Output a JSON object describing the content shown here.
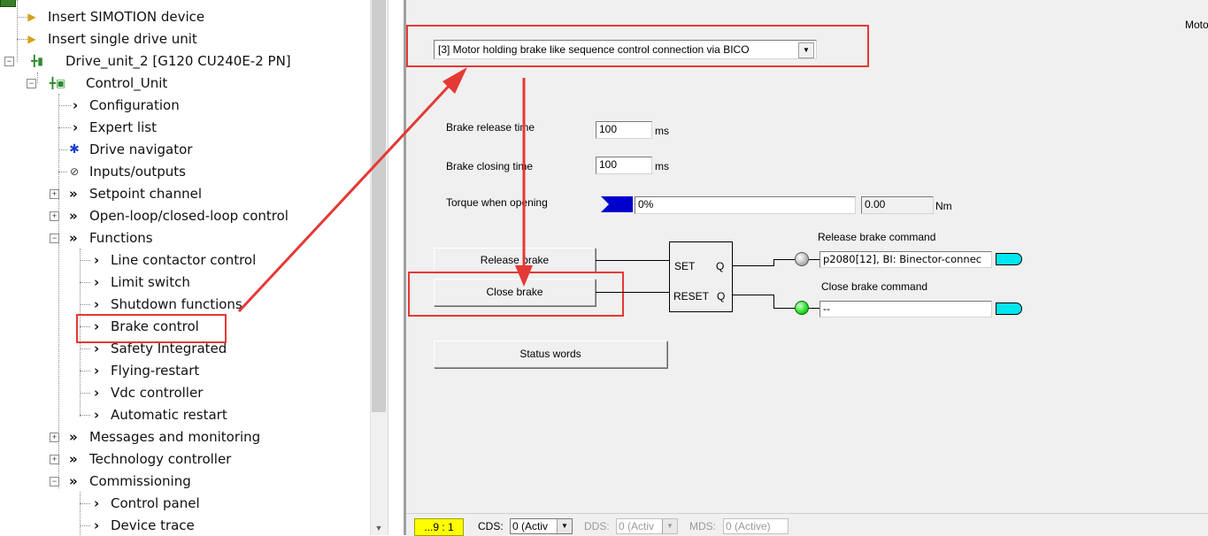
{
  "tree": {
    "items": [
      {
        "label": "Insert SIMOTION device",
        "icon": "insert-device-icon"
      },
      {
        "label": "Insert single drive unit",
        "icon": "insert-drive-icon"
      },
      {
        "label": "Drive_unit_2 [G120 CU240E-2 PN]",
        "icon": "drive-unit-icon"
      },
      {
        "label": "Control_Unit",
        "icon": "control-unit-icon"
      },
      {
        "label": "Configuration",
        "icon": "chevron-right-icon"
      },
      {
        "label": "Expert list",
        "icon": "chevron-right-icon"
      },
      {
        "label": "Drive navigator",
        "icon": "drive-navigator-icon"
      },
      {
        "label": "Inputs/outputs",
        "icon": "inputs-outputs-icon"
      },
      {
        "label": "Setpoint channel",
        "icon": "double-chevron-icon"
      },
      {
        "label": "Open-loop/closed-loop control",
        "icon": "double-chevron-icon"
      },
      {
        "label": "Functions",
        "icon": "double-chevron-icon"
      },
      {
        "label": "Line contactor control",
        "icon": "chevron-right-icon"
      },
      {
        "label": "Limit switch",
        "icon": "chevron-right-icon"
      },
      {
        "label": "Shutdown functions",
        "icon": "chevron-right-icon"
      },
      {
        "label": "Brake control",
        "icon": "chevron-right-icon"
      },
      {
        "label": "Safety Integrated",
        "icon": "chevron-right-icon"
      },
      {
        "label": "Flying-restart",
        "icon": "chevron-right-icon"
      },
      {
        "label": "Vdc controller",
        "icon": "chevron-right-icon"
      },
      {
        "label": "Automatic restart",
        "icon": "chevron-right-icon"
      },
      {
        "label": "Messages and monitoring",
        "icon": "double-chevron-icon"
      },
      {
        "label": "Technology controller",
        "icon": "double-chevron-icon"
      },
      {
        "label": "Commissioning",
        "icon": "double-chevron-icon"
      },
      {
        "label": "Control panel",
        "icon": "chevron-right-icon"
      },
      {
        "label": "Device trace",
        "icon": "chevron-right-icon"
      }
    ]
  },
  "panel": {
    "top_right_label": "Moto",
    "brake_mode": "[3] Motor holding brake like sequence control connection via BICO",
    "release_time": {
      "label": "Brake release time",
      "value": "100",
      "unit": "ms"
    },
    "closing_time": {
      "label": "Brake closing time",
      "value": "100",
      "unit": "ms"
    },
    "torque": {
      "label": "Torque when opening",
      "percent_text": "0%",
      "value": "0.00",
      "unit": "Nm",
      "percent": 0
    },
    "release_button": "Release brake",
    "close_button": "Close brake",
    "status_button": "Status words",
    "flipflop": {
      "set": "SET",
      "reset": "RESET",
      "q1": "Q",
      "q2": "Q"
    },
    "release_cmd": {
      "label": "Release brake command",
      "value": "p2080[12], BI: Binector-connec"
    },
    "close_cmd": {
      "label": "Close brake command",
      "value": "--"
    }
  },
  "statusbar": {
    "indicator": "...9 : 1",
    "cds_label": "CDS:",
    "cds_value": "0 (Activ",
    "dds_label": "DDS:",
    "dds_value": "0 (Activ",
    "mds_label": "MDS:",
    "mds_value": "0 (Active)"
  },
  "colors": {
    "annotation_red": "#e53935",
    "highlight_yellow": "#ffff00",
    "led_green": "#22dd22",
    "connector_cyan": "#00e5ee"
  }
}
